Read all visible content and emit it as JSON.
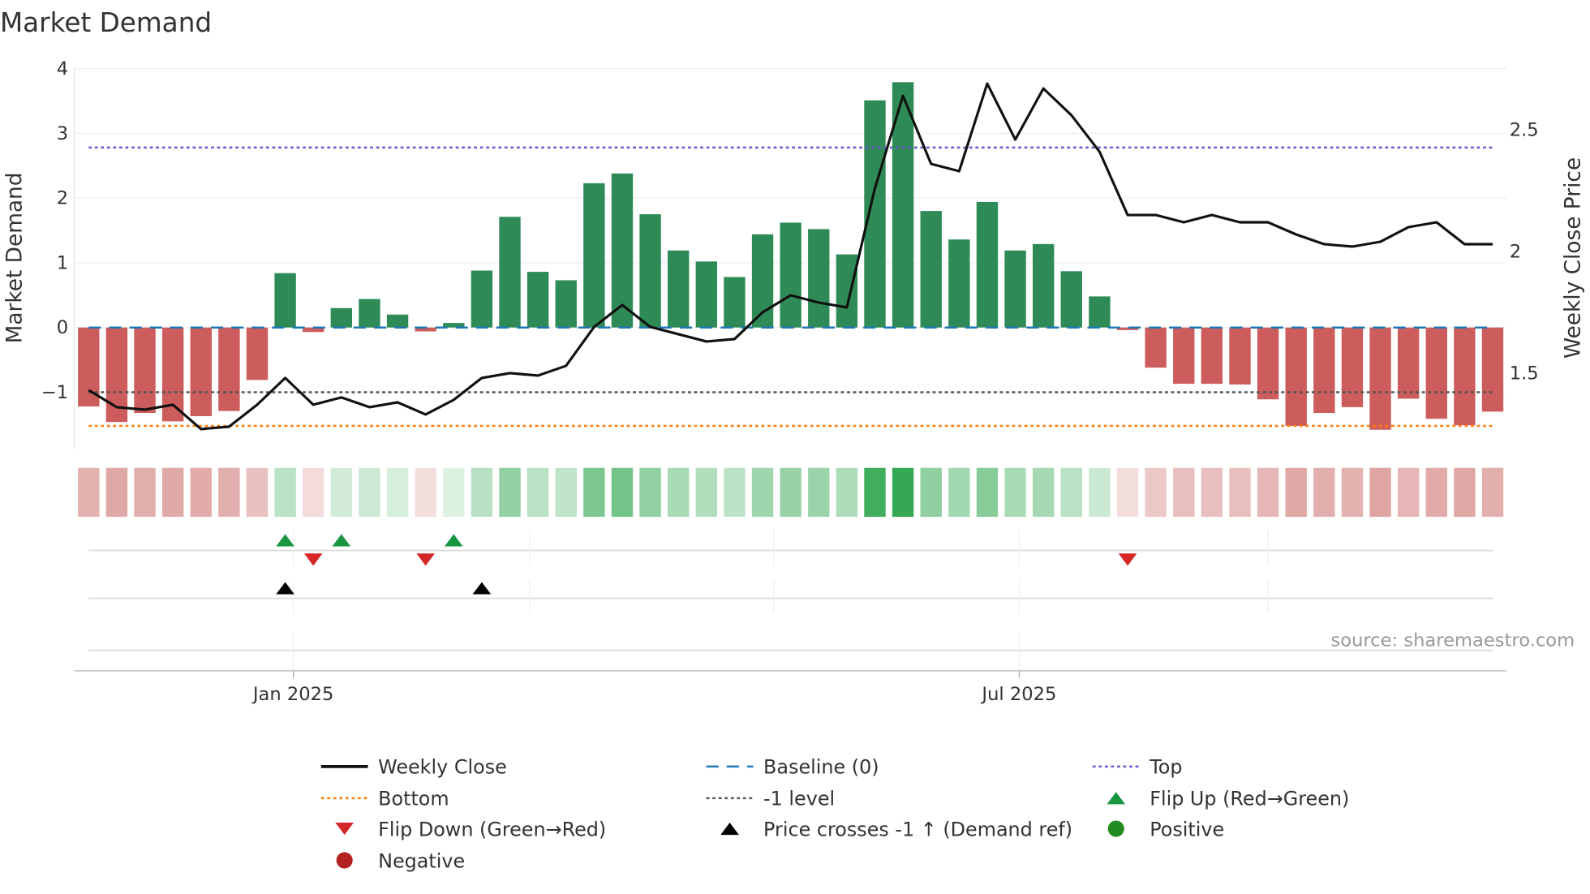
{
  "chart_data": {
    "type": "bar",
    "title": "Market Demand",
    "ylabel": "Market Demand",
    "y2label": "Weekly Close Price",
    "ylim": [
      -1.87,
      4.02
    ],
    "y2lim": [
      1.19,
      2.757
    ],
    "yticks": [
      {
        "v": 4,
        "label": "4"
      },
      {
        "v": 3,
        "label": "3"
      },
      {
        "v": 2,
        "label": "2"
      },
      {
        "v": 1,
        "label": "1"
      },
      {
        "v": 0,
        "label": "0"
      },
      {
        "v": -1,
        "label": "−1"
      }
    ],
    "y2ticks": [
      {
        "v": 2.5,
        "label": "2.5"
      },
      {
        "v": 2,
        "label": "2"
      },
      {
        "v": 1.5,
        "label": "1.5"
      }
    ],
    "xticks": [
      {
        "week": 7.29,
        "label": "Jan 2025"
      },
      {
        "week": 33.14,
        "label": "Jul 2025"
      }
    ],
    "minor_gridlines_week": [
      7.29,
      15.7,
      24.4,
      33.14,
      42.0
    ],
    "demand": [
      -1.22,
      -1.46,
      -1.32,
      -1.45,
      -1.37,
      -1.29,
      -0.81,
      0.84,
      -0.07,
      0.3,
      0.44,
      0.2,
      -0.06,
      0.07,
      0.88,
      1.71,
      0.86,
      0.73,
      2.23,
      2.38,
      1.75,
      1.19,
      1.02,
      0.78,
      1.44,
      1.62,
      1.52,
      1.13,
      3.51,
      3.79,
      1.8,
      1.36,
      1.94,
      1.19,
      1.29,
      0.87,
      0.48,
      -0.04,
      -0.62,
      -0.87,
      -0.87,
      -0.88,
      -1.11,
      -1.52,
      -1.32,
      -1.23,
      -1.58,
      -1.1,
      -1.41,
      -1.51,
      -1.3
    ],
    "weekly_close": [
      1.43,
      1.36,
      1.35,
      1.37,
      1.27,
      1.28,
      1.37,
      1.48,
      1.37,
      1.4,
      1.36,
      1.38,
      1.33,
      1.39,
      1.48,
      1.5,
      1.49,
      1.53,
      1.69,
      1.78,
      1.69,
      1.66,
      1.63,
      1.64,
      1.75,
      1.82,
      1.79,
      1.77,
      2.26,
      2.64,
      2.36,
      2.33,
      2.69,
      2.46,
      2.67,
      2.56,
      2.41,
      2.15,
      2.15,
      2.12,
      2.15,
      2.12,
      2.12,
      2.07,
      2.03,
      2.02,
      2.04,
      2.1,
      2.12,
      2.03,
      2.03
    ],
    "reference_lines": {
      "top": 2.78,
      "bottom": -1.52,
      "minus_one": -1,
      "baseline": 0
    },
    "flip_up_weeks": [
      7,
      9,
      13
    ],
    "flip_down_weeks": [
      8,
      12,
      37
    ],
    "price_cross_weeks": [
      7,
      14
    ],
    "colors": {
      "positive": "#2e8b57",
      "negative": "#cd5c5c",
      "price": "#111111",
      "baseline": "#1f77b4",
      "top": "#6a5acd",
      "bottom": "#ff7f0e",
      "minus_one": "#555555",
      "flip_up": "#1a9641",
      "flip_down": "#d62728",
      "cross": "#000000",
      "pos_dot": "#228b22",
      "neg_dot": "#b22222"
    },
    "legend": [
      {
        "label": "Weekly Close",
        "kind": "line"
      },
      {
        "label": "Baseline (0)",
        "kind": "dash"
      },
      {
        "label": "Top",
        "kind": "dot-top"
      },
      {
        "label": "Bottom",
        "kind": "dot-bottom"
      },
      {
        "label": "-1 level",
        "kind": "dot-minus"
      },
      {
        "label": "Flip Up (Red→Green)",
        "kind": "tri-up-green"
      },
      {
        "label": "Flip Down (Green→Red)",
        "kind": "tri-down-red"
      },
      {
        "label": "Price crosses -1 ↑ (Demand ref)",
        "kind": "tri-up-black"
      },
      {
        "label": "Positive",
        "kind": "dot-green"
      },
      {
        "label": "Negative",
        "kind": "dot-red"
      }
    ],
    "source": "source: sharemaestro.com"
  }
}
